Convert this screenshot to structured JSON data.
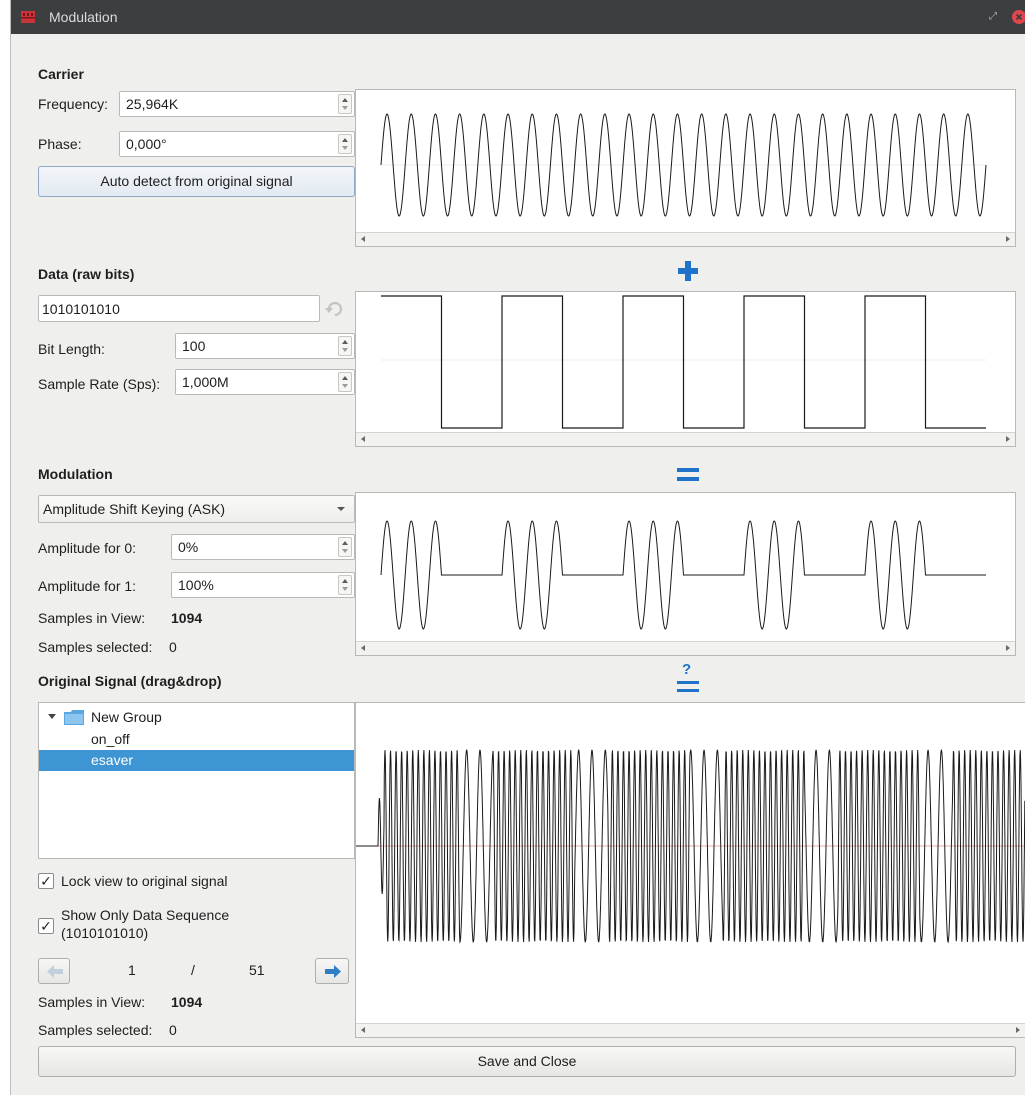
{
  "window": {
    "title": "Modulation",
    "restore_glyph": "⤢"
  },
  "carrier": {
    "heading": "Carrier",
    "frequency_label": "Frequency:",
    "frequency_value": "25,964K",
    "phase_label": "Phase:",
    "phase_value": "0,000°",
    "auto_detect_label": "Auto detect from original signal"
  },
  "operators": {
    "plus": "+",
    "equals": "=",
    "question": "?"
  },
  "data": {
    "heading": "Data (raw bits)",
    "bits_value": "1010101010",
    "bit_length_label": "Bit Length:",
    "bit_length_value": "100",
    "sample_rate_label": "Sample Rate (Sps):",
    "sample_rate_value": "1,000M"
  },
  "modulation": {
    "heading": "Modulation",
    "type_selected": "Amplitude Shift Keying (ASK)",
    "amp0_label": "Amplitude for 0:",
    "amp0_value": "0%",
    "amp1_label": "Amplitude for 1:",
    "amp1_value": "100%",
    "samples_in_view_label": "Samples in View:",
    "samples_in_view_value": "1094",
    "samples_selected_label": "Samples selected:",
    "samples_selected_value": "0"
  },
  "original": {
    "heading": "Original Signal (drag&drop)",
    "tree": {
      "group": "New Group",
      "items": [
        "on_off",
        "esaver"
      ],
      "selected_index": 1
    },
    "lock_view_label": "Lock view to original signal",
    "lock_view_checked": true,
    "show_only_data_label_line1": "Show Only Data Sequence",
    "show_only_data_label_line2": "(1010101010)",
    "show_only_data_checked": true,
    "page_current": "1",
    "page_separator": "/",
    "page_total": "51",
    "samples_in_view_label": "Samples in View:",
    "samples_in_view_value": "1094",
    "samples_selected_label": "Samples selected:",
    "samples_selected_value": "0"
  },
  "footer": {
    "save_close_label": "Save and Close"
  },
  "colors": {
    "accent": "#1f73c8",
    "selection": "#3d96d3",
    "titlebar": "#3c3e40",
    "close": "#e0464b",
    "signal": "#1a1a1a",
    "zero_line": "#e6a9a9"
  },
  "icons": {
    "app": "urh-logo-icon",
    "restore": "restore-icon",
    "close": "close-icon",
    "reset": "undo-icon",
    "folder": "folder-icon",
    "expand": "triangle-down-icon",
    "prev": "arrow-left-icon",
    "next": "arrow-right-icon"
  }
}
